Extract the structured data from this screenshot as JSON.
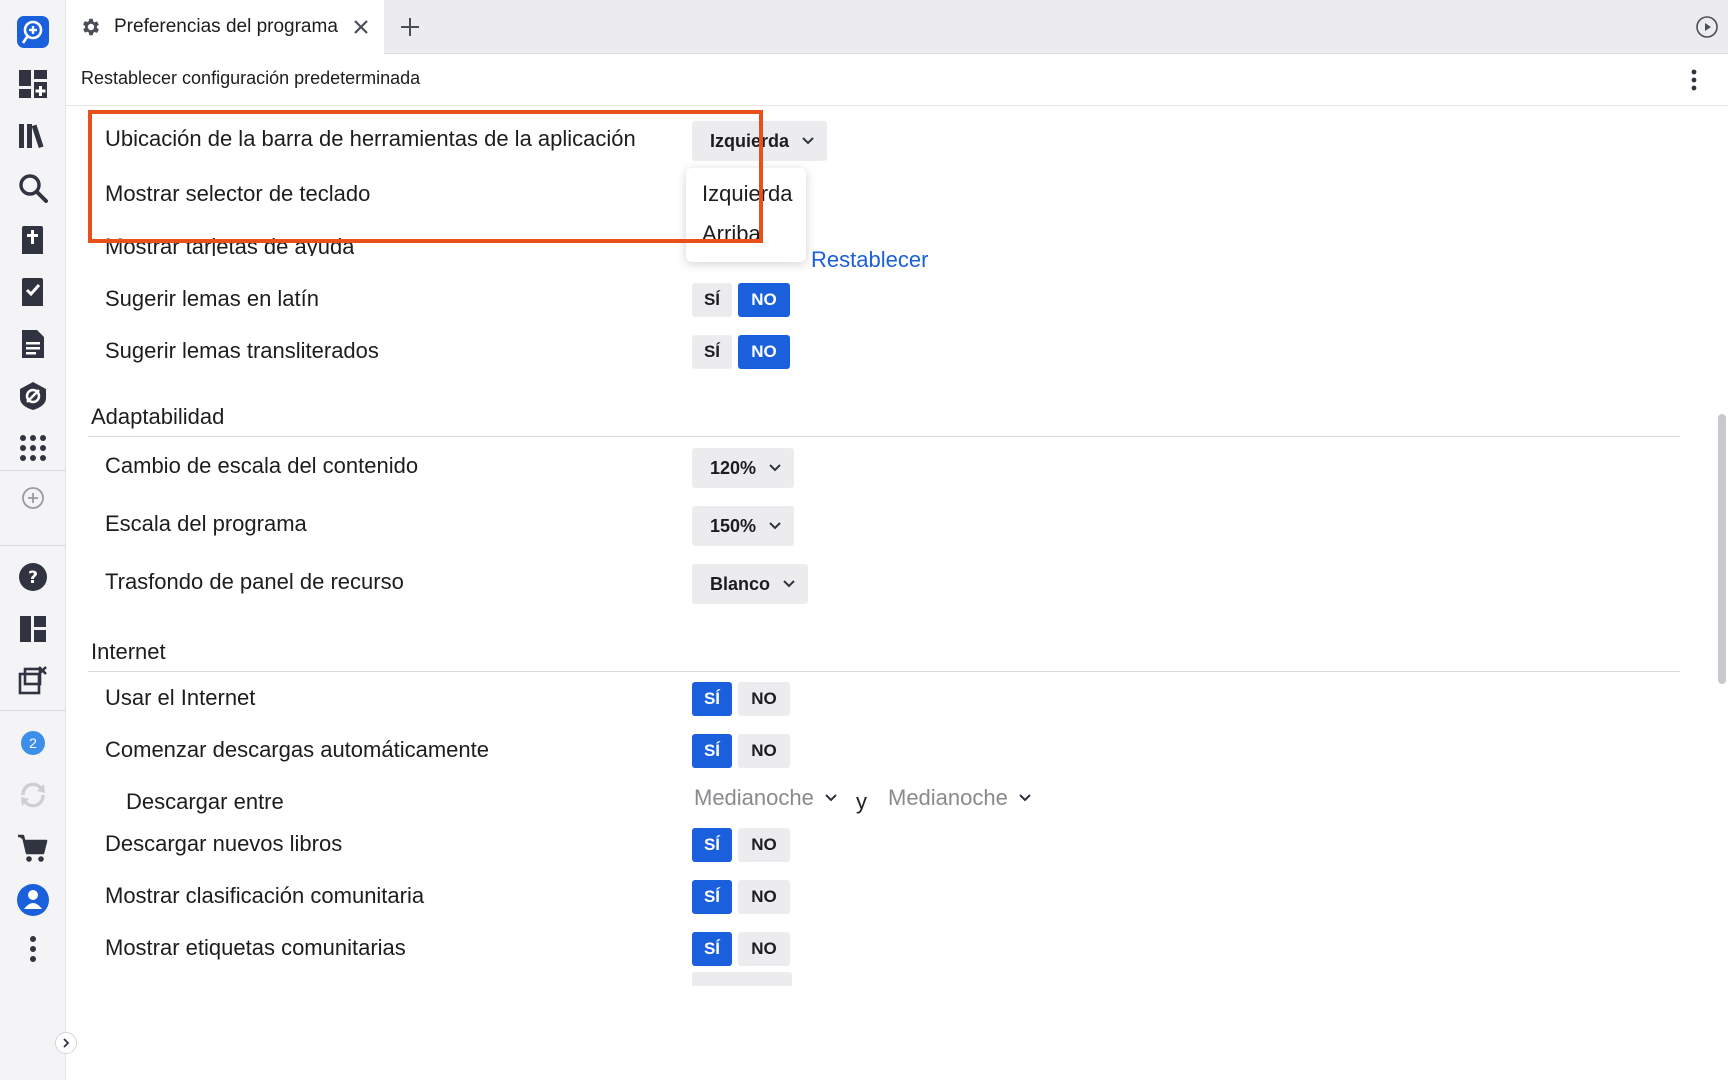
{
  "tabbar": {
    "tab_title": "Preferencias del programa",
    "tab_icon": "gear-icon",
    "close_icon": "close-icon",
    "add_icon": "plus-icon",
    "play_icon": "play-circle-icon"
  },
  "toolbar": {
    "reset_label": "Restablecer configuración predeterminada",
    "menu_icon": "kebab-menu-icon"
  },
  "sidebar": {
    "badge_count": "2",
    "accent": "#1a5fdc"
  },
  "settings": {
    "toolbar_location": {
      "label": "Ubicación de la barra de herramientas de la aplicación",
      "value": "Izquierda"
    },
    "keyboard_selector": {
      "label": "Mostrar selector de teclado"
    },
    "help_cards": {
      "label": "Mostrar tarjetas de ayuda",
      "reset": "Restablecer"
    },
    "latin_lemmas": {
      "label": "Sugerir lemas en latín",
      "yes": "SÍ",
      "no": "NO"
    },
    "translit_lemmas": {
      "label": "Sugerir lemas transliterados",
      "yes": "SÍ",
      "no": "NO"
    }
  },
  "dropdown": {
    "options": [
      "Izquierda",
      "Arriba"
    ]
  },
  "adaptability": {
    "title": "Adaptabilidad",
    "content_scale": {
      "label": "Cambio de escala del contenido",
      "value": "120%"
    },
    "program_scale": {
      "label": "Escala del programa",
      "value": "150%"
    },
    "panel_background": {
      "label": "Trasfondo de panel de recurso",
      "value": "Blanco"
    }
  },
  "internet": {
    "title": "Internet",
    "use_internet": {
      "label": "Usar el Internet",
      "yes": "SÍ",
      "no": "NO"
    },
    "auto_downloads": {
      "label": "Comenzar descargas automáticamente",
      "yes": "SÍ",
      "no": "NO"
    },
    "download_between": {
      "label": "Descargar entre",
      "from": "Medianoche",
      "separator": "y",
      "to": "Medianoche"
    },
    "new_books": {
      "label": "Descargar nuevos libros",
      "yes": "SÍ",
      "no": "NO"
    },
    "community_rating": {
      "label": "Mostrar clasificación comunitaria",
      "yes": "SÍ",
      "no": "NO"
    },
    "community_tags": {
      "label": "Mostrar etiquetas comunitarias",
      "yes": "SÍ",
      "no": "NO"
    }
  }
}
